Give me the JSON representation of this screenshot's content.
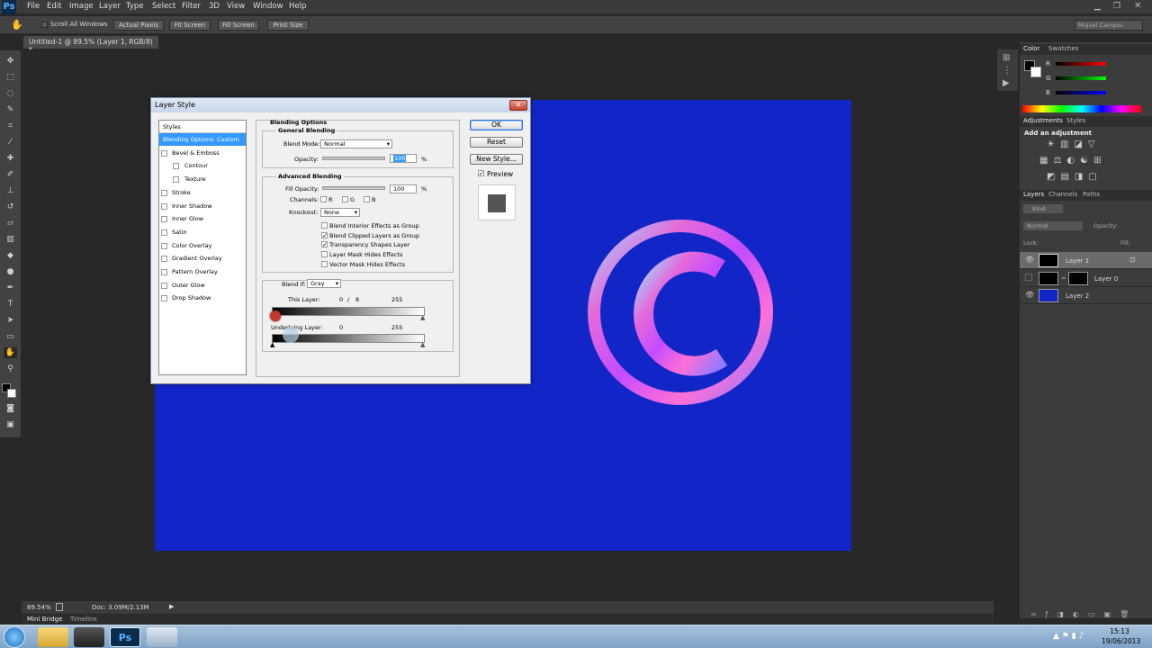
{
  "app": {
    "logo": "Ps"
  },
  "menu": [
    "File",
    "Edit",
    "Image",
    "Layer",
    "Type",
    "Select",
    "Filter",
    "3D",
    "View",
    "Window",
    "Help"
  ],
  "options_bar": {
    "scroll_all": "Scroll All Windows",
    "buttons": [
      "Actual Pixels",
      "Fit Screen",
      "Fill Screen",
      "Print Size"
    ],
    "workspace": "Miguel Campos"
  },
  "document_tab": "Untitled-1 @ 89.5% (Layer 1, RGB/8) *",
  "dialog": {
    "title": "Layer Style",
    "close": "✕",
    "styles_header": "Styles",
    "styles": [
      {
        "label": "Blending Options: Custom",
        "checkbox": false,
        "selected": true,
        "indent": false
      },
      {
        "label": "Bevel & Emboss",
        "checkbox": true,
        "selected": false,
        "indent": false
      },
      {
        "label": "Contour",
        "checkbox": true,
        "selected": false,
        "indent": true
      },
      {
        "label": "Texture",
        "checkbox": true,
        "selected": false,
        "indent": true
      },
      {
        "label": "Stroke",
        "checkbox": true,
        "selected": false,
        "indent": false
      },
      {
        "label": "Inner Shadow",
        "checkbox": true,
        "selected": false,
        "indent": false
      },
      {
        "label": "Inner Glow",
        "checkbox": true,
        "selected": false,
        "indent": false
      },
      {
        "label": "Satin",
        "checkbox": true,
        "selected": false,
        "indent": false
      },
      {
        "label": "Color Overlay",
        "checkbox": true,
        "selected": false,
        "indent": false
      },
      {
        "label": "Gradient Overlay",
        "checkbox": true,
        "selected": false,
        "indent": false
      },
      {
        "label": "Pattern Overlay",
        "checkbox": true,
        "selected": false,
        "indent": false
      },
      {
        "label": "Outer Glow",
        "checkbox": true,
        "selected": false,
        "indent": false
      },
      {
        "label": "Drop Shadow",
        "checkbox": true,
        "selected": false,
        "indent": false
      }
    ],
    "blending_options": "Blending Options",
    "general_blending": "General Blending",
    "blend_mode_label": "Blend Mode:",
    "blend_mode_value": "Normal",
    "opacity_label": "Opacity:",
    "opacity_value": "100",
    "percent": "%",
    "advanced_blending": "Advanced Blending",
    "fill_opacity_label": "Fill Opacity:",
    "fill_opacity_value": "100",
    "channels_label": "Channels:",
    "channels": [
      "R",
      "G",
      "B"
    ],
    "knockout_label": "Knockout:",
    "knockout_value": "None",
    "checkboxes": [
      {
        "label": "Blend Interior Effects as Group",
        "checked": false
      },
      {
        "label": "Blend Clipped Layers as Group",
        "checked": true
      },
      {
        "label": "Transparency Shapes Layer",
        "checked": true
      },
      {
        "label": "Layer Mask Hides Effects",
        "checked": false
      },
      {
        "label": "Vector Mask Hides Effects",
        "checked": false
      }
    ],
    "blend_if_label": "Blend If:",
    "blend_if_value": "Gray",
    "this_layer_label": "This Layer:",
    "this_layer_low": "0",
    "this_layer_slash": "/",
    "this_layer_split": "8",
    "this_layer_high": "255",
    "underlying_label": "Underlying Layer:",
    "underlying_low": "0",
    "underlying_high": "255",
    "ok": "OK",
    "reset": "Reset",
    "new_style": "New Style...",
    "preview": "Preview",
    "preview_checked": true
  },
  "right_panel": {
    "color_tabs": [
      "Color",
      "Swatches"
    ],
    "rgb_labels": [
      "R",
      "G",
      "B"
    ],
    "adjust_tabs": [
      "Adjustments",
      "Styles"
    ],
    "add_adjustment": "Add an adjustment",
    "layer_tabs": [
      "Layers",
      "Channels",
      "Paths"
    ],
    "kind": "Kind",
    "blend": "Normal",
    "opacity": "Opacity:",
    "lock": "Lock:",
    "fill": "Fill:",
    "layers": [
      {
        "name": "Layer 1",
        "selected": true
      },
      {
        "name": "Layer 0",
        "selected": false
      },
      {
        "name": "Layer 2",
        "selected": false
      }
    ]
  },
  "status": {
    "zoom": "89.54%",
    "doc": "Doc: 3.09M/2.13M"
  },
  "bottom_tabs": [
    "Mini Bridge",
    "Timeline"
  ],
  "clock": {
    "time": "15:13",
    "date": "19/06/2013"
  },
  "colors": {
    "canvas": "#1226c8",
    "selection": "#3399ff",
    "accent": "#2b6fdc"
  }
}
